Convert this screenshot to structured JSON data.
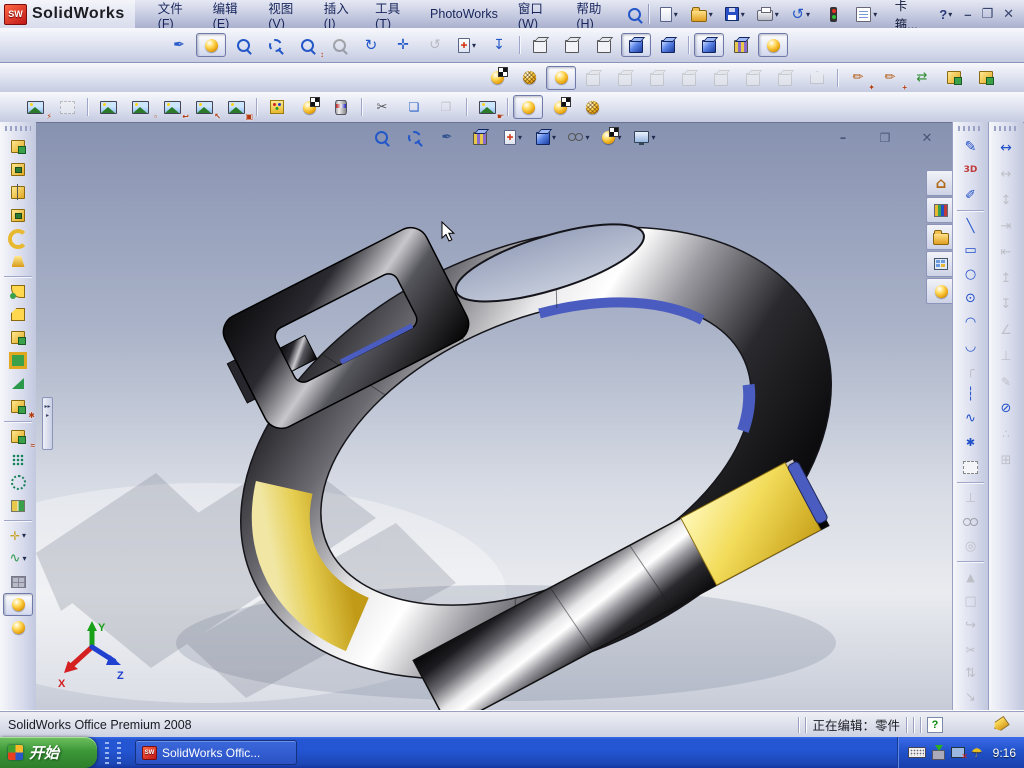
{
  "titlebar": {
    "logo_sw": "SW",
    "logo_text": "SolidWorks",
    "doc_name": "卡箍...",
    "help_label": "?",
    "controls": {
      "minimize": "–",
      "restore": "❐",
      "close": "✕"
    }
  },
  "menubar": {
    "items": [
      {
        "label": "文件(F)"
      },
      {
        "label": "编辑(E)"
      },
      {
        "label": "视图(V)"
      },
      {
        "label": "插入(I)"
      },
      {
        "label": "工具(T)"
      },
      {
        "label": "PhotoWorks"
      },
      {
        "label": "窗口(W)"
      },
      {
        "label": "帮助(H)"
      }
    ]
  },
  "quickbar": {
    "icons": [
      {
        "name": "new-document-icon",
        "shape": "page",
        "dd": true
      },
      {
        "name": "open-icon",
        "shape": "folder",
        "dd": true
      },
      {
        "name": "save-icon",
        "shape": "floppy",
        "dd": true
      },
      {
        "name": "print-icon",
        "shape": "print",
        "dd": true
      },
      {
        "name": "undo-icon",
        "glyph": "↺",
        "fg": "#2457c8",
        "fs": 15,
        "dd": true
      },
      {
        "name": "rebuild-traffic-light-icon",
        "shape": "traffic"
      },
      {
        "name": "options-icon",
        "shape": "options",
        "dd": true
      }
    ]
  },
  "toolbars": {
    "view": {
      "icons": [
        {
          "type": "handle"
        },
        {
          "name": "fly-wand-icon",
          "glyph": "✒",
          "fg": "#2457c8",
          "fs": 14
        },
        {
          "name": "realview-ball-icon",
          "shape": "ball",
          "pressed": true
        },
        {
          "name": "zoom-to-fit-icon",
          "shape": "mag"
        },
        {
          "name": "zoom-to-area-icon",
          "shape": "maga"
        },
        {
          "name": "zoom-in-out-icon",
          "shape": "mag",
          "ov": "↕"
        },
        {
          "name": "zoom-to-selection-icon",
          "shape": "mag",
          "disabled": true
        },
        {
          "name": "rotate-view-icon",
          "glyph": "↻",
          "fg": "#2457c8",
          "fs": 15
        },
        {
          "name": "pan-icon",
          "glyph": "✛",
          "fg": "#2457c8",
          "fs": 14
        },
        {
          "name": "rotate-about-scene-floor-icon",
          "glyph": "↺",
          "fg": "#888",
          "fs": 14,
          "disabled": true
        },
        {
          "name": "section-view-icon",
          "shape": "section",
          "dd": true
        },
        {
          "name": "normal-to-icon",
          "glyph": "↧",
          "fg": "#2457c8",
          "fs": 14
        },
        {
          "type": "sep"
        },
        {
          "name": "wireframe-icon",
          "shape": "cubew"
        },
        {
          "name": "hidden-lines-visible-icon",
          "shape": "cubew"
        },
        {
          "name": "hidden-lines-removed-icon",
          "shape": "cubew"
        },
        {
          "name": "shaded-with-edges-icon",
          "shape": "cube",
          "pressed": true
        },
        {
          "name": "shaded-icon",
          "shape": "cube"
        },
        {
          "type": "sep"
        },
        {
          "name": "shadows-in-shaded-mode-icon",
          "shape": "cube",
          "pressed": true
        },
        {
          "name": "apply-texture-icon",
          "shape": "cubetex"
        },
        {
          "name": "realview-graphics-icon",
          "shape": "ball",
          "pressed": true
        }
      ]
    },
    "render": {
      "icons": [
        {
          "type": "handle"
        },
        {
          "name": "render-icon",
          "shape": "ballflag"
        },
        {
          "name": "render-region-icon",
          "shape": "ballmesh"
        },
        {
          "name": "render-preview-icon",
          "shape": "ball",
          "pressed": true
        },
        {
          "name": "photoworks-option-1-icon",
          "shape": "cubeg",
          "disabled": true
        },
        {
          "name": "photoworks-option-2-icon",
          "shape": "cubeg",
          "disabled": true
        },
        {
          "name": "photoworks-option-3-icon",
          "shape": "cubeg",
          "disabled": true
        },
        {
          "name": "photoworks-option-4-icon",
          "shape": "cubeg",
          "disabled": true
        },
        {
          "name": "photoworks-option-5-icon",
          "shape": "cubeg",
          "disabled": true
        },
        {
          "name": "photoworks-option-6-icon",
          "shape": "cubeg",
          "disabled": true
        },
        {
          "name": "photoworks-option-7-icon",
          "shape": "cubeg",
          "disabled": true
        },
        {
          "name": "photoworks-option-8-icon",
          "shape": "prism",
          "disabled": true
        },
        {
          "type": "sep"
        },
        {
          "name": "new-decal-icon",
          "glyph": "✏",
          "fg": "#b05a10",
          "fs": 13,
          "ov": "✦"
        },
        {
          "name": "edit-decal-icon",
          "glyph": "✏",
          "fg": "#b05a10",
          "fs": 13,
          "ov": "+"
        },
        {
          "name": "appearance-hierarchy-icon",
          "glyph": "⇄",
          "fg": "#2a8a2a",
          "fs": 13
        },
        {
          "name": "copy-appearance-icon",
          "shape": "feature"
        },
        {
          "name": "paste-appearance-icon",
          "shape": "feature"
        }
      ]
    },
    "photoworks": {
      "icons": [
        {
          "type": "handle"
        },
        {
          "name": "render-image-icon",
          "shape": "pic",
          "ov": "⚡"
        },
        {
          "name": "render-frame-icon",
          "shape": "dashrect",
          "disabled": true
        },
        {
          "type": "sep"
        },
        {
          "name": "open-image-icon",
          "shape": "pic"
        },
        {
          "name": "select-image-area-icon",
          "shape": "pic",
          "ov": "▫"
        },
        {
          "name": "previous-image-icon",
          "shape": "pic",
          "ov": "↩"
        },
        {
          "name": "pick-image-icon",
          "shape": "pic",
          "ov": "↖"
        },
        {
          "name": "save-image-icon",
          "shape": "pic",
          "ov": "▣"
        },
        {
          "type": "sep"
        },
        {
          "name": "scene-editor-icon",
          "shape": "card"
        },
        {
          "name": "render-settings-icon",
          "shape": "ballflag"
        },
        {
          "name": "appearance-can-icon",
          "shape": "can"
        },
        {
          "type": "sep"
        },
        {
          "name": "cut-appearance-icon",
          "glyph": "✂",
          "fg": "#555",
          "fs": 13
        },
        {
          "name": "copy-colors-icon",
          "glyph": "❏",
          "fg": "#2a62c8",
          "fs": 12
        },
        {
          "name": "paste-colors-icon",
          "glyph": "❐",
          "fg": "#999",
          "fs": 12,
          "disabled": true
        },
        {
          "type": "sep"
        },
        {
          "name": "image-editor-icon",
          "shape": "pic",
          "ov": "☛"
        },
        {
          "type": "sep"
        },
        {
          "name": "photoworks-ball-icon",
          "shape": "ball",
          "pressed": true
        },
        {
          "name": "photoworks-render-icon",
          "shape": "ballflag"
        },
        {
          "name": "photoworks-region-icon",
          "shape": "ballmesh"
        }
      ]
    },
    "features": {
      "icons": [
        {
          "type": "handle-h"
        },
        {
          "name": "extruded-boss-icon",
          "shape": "feature"
        },
        {
          "name": "extruded-cut-icon",
          "shape": "featcut"
        },
        {
          "name": "revolved-boss-icon",
          "shape": "featrev"
        },
        {
          "name": "revolved-cut-icon",
          "shape": "featcut"
        },
        {
          "name": "swept-boss-icon",
          "shape": "sweep"
        },
        {
          "name": "lofted-boss-icon",
          "shape": "loft"
        },
        {
          "type": "sep-h"
        },
        {
          "name": "fillet-icon",
          "shape": "fillet"
        },
        {
          "name": "chamfer-icon",
          "shape": "chamfer"
        },
        {
          "name": "rib-icon",
          "shape": "feature"
        },
        {
          "name": "shell-icon",
          "shape": "shell"
        },
        {
          "name": "draft-icon",
          "shape": "wedge"
        },
        {
          "name": "hole-wizard-icon",
          "shape": "feature",
          "ov": "✱"
        },
        {
          "type": "sep-h"
        },
        {
          "name": "wrap-icon",
          "shape": "feature",
          "ov": "≈"
        },
        {
          "name": "linear-pattern-icon",
          "shape": "patl"
        },
        {
          "name": "circular-pattern-icon",
          "shape": "patc"
        },
        {
          "name": "mirror-icon",
          "shape": "mirrorf"
        },
        {
          "type": "sep-h"
        },
        {
          "name": "reference-geometry-icon",
          "glyph": "✛",
          "fg": "#c8a020",
          "fs": 12,
          "dd": true
        },
        {
          "name": "curves-icon",
          "glyph": "∿",
          "fg": "#2a9a4a",
          "fs": 13,
          "dd": true
        },
        {
          "name": "instant3d-icon",
          "shape": "brick"
        },
        {
          "name": "appearance-ball-icon",
          "shape": "ball",
          "pressed": true
        },
        {
          "name": "material-ball-icon",
          "shape": "ball"
        }
      ]
    },
    "sketch": {
      "icons": [
        {
          "type": "handle-h"
        },
        {
          "name": "sketch-icon",
          "glyph": "✎",
          "fg": "#2050c8",
          "fs": 14
        },
        {
          "name": "sketch-3d-icon",
          "glyph": "3D",
          "fg": "#c03a3a",
          "fs": 9,
          "bold": true
        },
        {
          "name": "smart-dimension-sketch-icon",
          "glyph": "✐",
          "fg": "#2050c8",
          "fs": 13
        },
        {
          "type": "sep-h"
        },
        {
          "name": "line-icon",
          "glyph": "╲",
          "fg": "#2050c8",
          "fs": 13
        },
        {
          "name": "rectangle-icon",
          "glyph": "▭",
          "fg": "#2050c8",
          "fs": 13
        },
        {
          "name": "circle-icon",
          "glyph": "○",
          "fg": "#2050c8",
          "fs": 13
        },
        {
          "name": "centerpoint-arc-icon",
          "glyph": "⊙",
          "fg": "#2050c8",
          "fs": 13
        },
        {
          "name": "tangent-arc-icon",
          "glyph": "◠",
          "fg": "#2050c8",
          "fs": 13
        },
        {
          "name": "three-point-arc-icon",
          "glyph": "◡",
          "fg": "#2050c8",
          "fs": 13
        },
        {
          "name": "sketch-fillet-icon",
          "glyph": "╭",
          "fg": "#999",
          "fs": 13,
          "disabled": true
        },
        {
          "name": "centerline-icon",
          "glyph": "┆",
          "fg": "#2050c8",
          "fs": 13
        },
        {
          "name": "spline-icon",
          "glyph": "∿",
          "fg": "#2050c8",
          "fs": 13
        },
        {
          "name": "point-icon",
          "glyph": "✱",
          "fg": "#2050c8",
          "fs": 11
        },
        {
          "name": "select-box-icon",
          "shape": "dashrect"
        },
        {
          "type": "sep-h"
        },
        {
          "name": "add-relation-icon",
          "glyph": "⊥",
          "fg": "#999",
          "fs": 13,
          "disabled": true
        },
        {
          "name": "display-relations-icon",
          "shape": "glasses",
          "disabled": true
        },
        {
          "name": "quick-snaps-icon",
          "glyph": "◎",
          "fg": "#999",
          "fs": 13,
          "disabled": true
        },
        {
          "type": "sep-h"
        },
        {
          "name": "mirror-entities-icon",
          "glyph": "▲",
          "fg": "#999",
          "fs": 11,
          "disabled": true
        },
        {
          "name": "convert-entities-icon",
          "glyph": "□",
          "fg": "#999",
          "fs": 13,
          "disabled": true
        },
        {
          "name": "offset-entities-icon",
          "glyph": "↪",
          "fg": "#999",
          "fs": 13,
          "disabled": true
        },
        {
          "name": "trim-entities-icon",
          "glyph": "✂",
          "fg": "#999",
          "fs": 12,
          "disabled": true
        },
        {
          "name": "extend-entities-icon",
          "glyph": "⇅",
          "fg": "#999",
          "fs": 13,
          "disabled": true
        },
        {
          "name": "move-entities-icon",
          "glyph": "↘",
          "fg": "#999",
          "fs": 13,
          "disabled": true
        }
      ]
    },
    "dimensions": {
      "icons": [
        {
          "type": "handle-h"
        },
        {
          "name": "smart-dimension-icon",
          "glyph": "↔",
          "fg": "#2050c8",
          "fs": 14
        },
        {
          "name": "horizontal-dimension-icon",
          "glyph": "↔",
          "fg": "#999",
          "fs": 13,
          "disabled": true
        },
        {
          "name": "vertical-dimension-icon",
          "glyph": "↕",
          "fg": "#999",
          "fs": 13,
          "disabled": true
        },
        {
          "name": "baseline-dimension-icon",
          "glyph": "⇥",
          "fg": "#999",
          "fs": 13,
          "disabled": true
        },
        {
          "name": "ordinate-dimension-icon",
          "glyph": "⇤",
          "fg": "#999",
          "fs": 13,
          "disabled": true
        },
        {
          "name": "horizontal-ordinate-icon",
          "glyph": "↥",
          "fg": "#999",
          "fs": 13,
          "disabled": true
        },
        {
          "name": "vertical-ordinate-icon",
          "glyph": "↧",
          "fg": "#999",
          "fs": 13,
          "disabled": true
        },
        {
          "name": "chamfer-dimension-icon",
          "glyph": "∠",
          "fg": "#999",
          "fs": 13,
          "disabled": true
        },
        {
          "name": "align-relation-icon",
          "glyph": "⊥",
          "fg": "#999",
          "fs": 13,
          "disabled": true
        },
        {
          "name": "sketch-picture-icon",
          "glyph": "✎",
          "fg": "#999",
          "fs": 12,
          "disabled": true
        },
        {
          "name": "ellipse-icon",
          "glyph": "⊘",
          "fg": "#2050c8",
          "fs": 13
        },
        {
          "name": "sketch-points-icon",
          "glyph": "∴",
          "fg": "#999",
          "fs": 12,
          "disabled": true
        },
        {
          "name": "grid-icon",
          "glyph": "⊞",
          "fg": "#999",
          "fs": 13,
          "disabled": true
        }
      ]
    }
  },
  "viewport": {
    "headsup": {
      "icons": [
        {
          "name": "hud-zoom-fit-icon",
          "shape": "mag",
          "flat": true
        },
        {
          "name": "hud-zoom-area-icon",
          "shape": "maga",
          "flat": true
        },
        {
          "name": "hud-wand-icon",
          "glyph": "✒",
          "fg": "#31518f",
          "fs": 13,
          "flat": true
        },
        {
          "name": "hud-texture-icon",
          "shape": "cubetex",
          "flat": true
        },
        {
          "name": "hud-section-view-icon",
          "shape": "section",
          "dd": true,
          "flat": true
        },
        {
          "name": "hud-view-orientation-icon",
          "shape": "cube",
          "dd": true,
          "flat": true
        },
        {
          "name": "hud-display-style-icon",
          "shape": "glasses",
          "dd": true,
          "flat": true
        },
        {
          "name": "hud-appearance-icon",
          "shape": "ballflag",
          "dd": true,
          "flat": true
        },
        {
          "name": "hud-scene-icon",
          "shape": "monitor",
          "dd": true,
          "flat": true
        }
      ]
    },
    "doc_controls": [
      {
        "name": "doc-minimize-icon",
        "glyph": "–",
        "fg": "#4a5578",
        "fs": 13,
        "flat": true
      },
      {
        "name": "doc-restore-icon",
        "glyph": "❐",
        "fg": "#4a5578",
        "fs": 12,
        "flat": true
      },
      {
        "name": "doc-close-icon",
        "glyph": "✕",
        "fg": "#4a5578",
        "fs": 13,
        "flat": true
      }
    ],
    "triad": {
      "x": "X",
      "y": "Y",
      "z": "Z"
    },
    "splitter_arrows": "▸▸▸"
  },
  "task_pane": {
    "tabs": [
      {
        "name": "resources-tab-home-icon",
        "glyph": "⌂",
        "fg": "#b06a1a",
        "fs": 15,
        "bold": true
      },
      {
        "name": "design-library-tab-icon",
        "shape": "lib"
      },
      {
        "name": "file-explorer-tab-icon",
        "shape": "folder"
      },
      {
        "name": "view-palette-tab-icon",
        "shape": "palette"
      },
      {
        "name": "photoworks-items-tab-icon",
        "shape": "ball"
      }
    ]
  },
  "statusbar": {
    "product": "SolidWorks Office Premium 2008",
    "editing": "正在编辑：零件",
    "help_glyph": "?"
  },
  "taskbar": {
    "start_label": "开始",
    "task_label": "SolidWorks Offic...",
    "task_icon": "SW",
    "clock": "9:16"
  },
  "colors": {
    "taskbar_blue": "#2456d4",
    "start_green": "#3c9838",
    "gold": "#e8c84a",
    "chrome_dark": "#141414",
    "viewport_top": "#8792b1",
    "accent_blue": "#2457c8"
  }
}
